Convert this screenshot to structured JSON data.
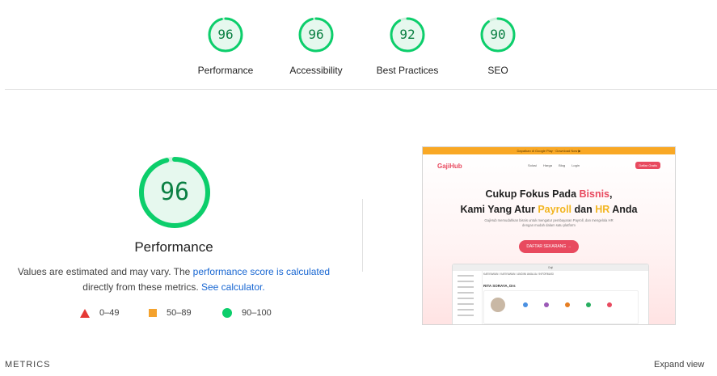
{
  "summary": {
    "gauges": [
      {
        "label": "Performance",
        "score": "96"
      },
      {
        "label": "Accessibility",
        "score": "96"
      },
      {
        "label": "Best Practices",
        "score": "92"
      },
      {
        "label": "SEO",
        "score": "90"
      }
    ]
  },
  "performance": {
    "score": "96",
    "title": "Performance",
    "note_prefix": "Values are estimated and may vary. The ",
    "note_link1": "performance score is calculated",
    "note_middle": "directly from these metrics. ",
    "note_link2": "See calculator.",
    "legend": [
      {
        "shape": "triangle",
        "range": "0–49",
        "color": "#e53935"
      },
      {
        "shape": "square",
        "range": "50–89",
        "color": "#f4a22d"
      },
      {
        "shape": "circle",
        "range": "90–100",
        "color": "#0cce6b"
      }
    ]
  },
  "screenshot": {
    "promo": "Dapatkan di Google Play · Download Now ▶",
    "logo": "GajiHub",
    "nav": [
      "Solusi",
      "Harga",
      "Blog",
      "Login"
    ],
    "cta_top": "Daftar Gratis",
    "headline_1a": "Cukup Fokus Pada ",
    "headline_1b": "Bisnis",
    "headline_1c": ",",
    "headline_2a": "Kami Yang Atur ",
    "headline_2b": "Payroll",
    "headline_2c": " dan ",
    "headline_2d": "HR",
    "headline_2e": " Anda",
    "sub": "GajiHub memudahkan bisnis untuk mengatur pembayaran Payroll, dan mengelola HR dengan mudah dalam satu platform",
    "button": "DAFTAR SEKARANG →",
    "app_url": "Gaji",
    "app_crumb": "KARYAWAN / KARYAWAN / ANDINI AMALIA / INFORMASI",
    "app_name": "RITA SORAYA, Drs"
  },
  "footer": {
    "metrics": "METRICS",
    "expand": "Expand view"
  },
  "colors": {
    "pass": "#0cce6b",
    "pass_text": "#0b8043",
    "link": "#1967d2"
  }
}
